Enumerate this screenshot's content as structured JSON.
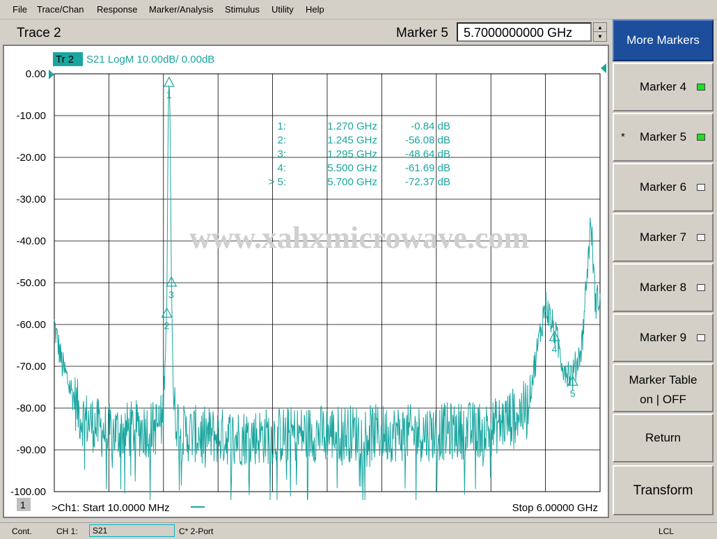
{
  "menu": [
    "File",
    "Trace/Chan",
    "Response",
    "Marker/Analysis",
    "Stimulus",
    "Utility",
    "Help"
  ],
  "title": {
    "trace": "Trace 2",
    "marker_label": "Marker 5",
    "marker_value": "5.7000000000 GHz"
  },
  "plot": {
    "trace_tag": "Tr 2",
    "trace_desc": "S21 LogM 10.00dB/  0.00dB",
    "channel_badge": "1",
    "start_label": ">Ch1: Start  10.0000 MHz",
    "stop_label": "Stop  6.00000 GHz",
    "watermark": "www.xahxmicrowave.com",
    "trace_color": "#1aa6a0",
    "y_ticks": [
      "0.00",
      "-10.00",
      "-20.00",
      "-30.00",
      "-40.00",
      "-50.00",
      "-60.00",
      "-70.00",
      "-80.00",
      "-90.00",
      "-100.00"
    ]
  },
  "marker_table": [
    {
      "num": "1:",
      "freq": "1.270 GHz",
      "val": "-0.84 dB"
    },
    {
      "num": "2:",
      "freq": "1.245 GHz",
      "val": "-56.08 dB"
    },
    {
      "num": "3:",
      "freq": "1.295 GHz",
      "val": "-48.64 dB"
    },
    {
      "num": "4:",
      "freq": "5.500 GHz",
      "val": "-61.69 dB"
    },
    {
      "num": "> 5:",
      "freq": "5.700 GHz",
      "val": "-72.37 dB"
    }
  ],
  "chart_data": {
    "type": "line",
    "xlabel": "",
    "ylabel": "",
    "x_range_ghz": [
      0.01,
      6.0
    ],
    "ylim": [
      -100,
      0
    ],
    "series": [
      {
        "x_ghz": [
          0.01,
          0.1,
          0.3,
          0.6,
          0.9,
          1.1,
          1.2,
          1.245,
          1.26,
          1.27,
          1.28,
          1.295,
          1.32,
          1.4,
          2.0,
          3.0,
          4.0,
          4.8,
          5.2,
          5.4,
          5.5,
          5.6,
          5.7,
          5.8,
          5.9,
          5.95,
          6.0
        ],
        "y_db": [
          -60,
          -70,
          -82,
          -86,
          -85,
          -85,
          -83,
          -56.08,
          -10,
          -0.84,
          -10,
          -48.64,
          -80,
          -86,
          -87,
          -86,
          -86,
          -85,
          -80,
          -55,
          -61.69,
          -70,
          -72.37,
          -65,
          -35,
          -55,
          -53
        ]
      }
    ],
    "markers": [
      {
        "id": "1",
        "x_ghz": 1.27,
        "y_db": -0.84
      },
      {
        "id": "2",
        "x_ghz": 1.245,
        "y_db": -56.08
      },
      {
        "id": "3",
        "x_ghz": 1.295,
        "y_db": -48.64
      },
      {
        "id": "4",
        "x_ghz": 5.5,
        "y_db": -61.69
      },
      {
        "id": "5",
        "x_ghz": 5.7,
        "y_db": -72.37
      }
    ],
    "grid": true
  },
  "softkeys": [
    {
      "label": "More Markers",
      "active": true
    },
    {
      "label": "Marker 4",
      "led": "on"
    },
    {
      "label": "Marker 5",
      "led": "on",
      "selected": true
    },
    {
      "label": "Marker 6",
      "led": "off"
    },
    {
      "label": "Marker 7",
      "led": "off"
    },
    {
      "label": "Marker 8",
      "led": "off"
    },
    {
      "label": "Marker 9",
      "led": "off"
    },
    {
      "label": "Marker Table",
      "label2": "on | OFF"
    },
    {
      "label": "Return"
    },
    {
      "label": "Transform"
    }
  ],
  "status": {
    "mode": "Cont.",
    "channel": "CH 1:",
    "measurement": "S21",
    "cal": "C* 2-Port",
    "remote": "LCL"
  }
}
